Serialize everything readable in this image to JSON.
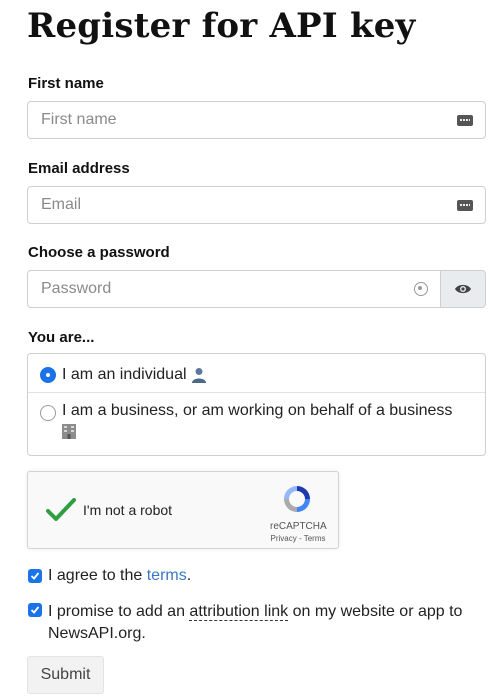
{
  "page": {
    "title": "Register for API key"
  },
  "form": {
    "first_name": {
      "label": "First name",
      "placeholder": "First name"
    },
    "email": {
      "label": "Email address",
      "placeholder": "Email"
    },
    "password": {
      "label": "Choose a password",
      "placeholder": "Password"
    },
    "you_are": {
      "label": "You are...",
      "options": [
        {
          "label": "I am an individual",
          "selected": true
        },
        {
          "label": "I am a business, or am working on behalf of a business",
          "selected": false
        }
      ]
    },
    "captcha": {
      "label": "I'm not a robot",
      "brand": "reCAPTCHA",
      "links": "Privacy - Terms"
    },
    "agree_terms": {
      "prefix": "I agree to the ",
      "link": "terms",
      "suffix": ".",
      "checked": true
    },
    "attribution": {
      "prefix": "I promise to add an ",
      "link": "attribution link",
      "suffix_line1": " on my website or app to",
      "line2": "NewsAPI.org.",
      "checked": true
    },
    "submit_label": "Submit"
  },
  "colors": {
    "accent": "#1a73e8",
    "link": "#3b78c4",
    "captcha_check": "#2e9e43"
  }
}
